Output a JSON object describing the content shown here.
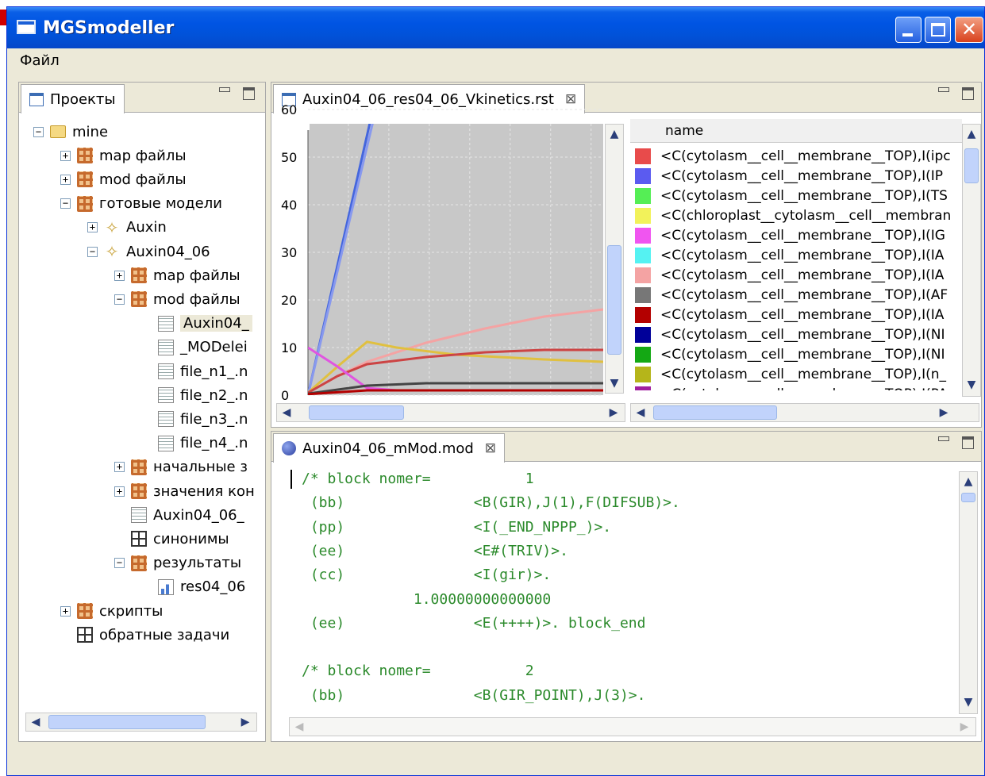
{
  "window": {
    "title": "MGSmodeller"
  },
  "menu": {
    "file": "Файл"
  },
  "projects_panel": {
    "tab_label": "Проекты",
    "tree": [
      {
        "label": "mine",
        "icon": "folder-icon",
        "expander": "−",
        "depth": 0
      },
      {
        "label": "map файлы",
        "icon": "package-icon",
        "expander": "+",
        "depth": 1
      },
      {
        "label": "mod файлы",
        "icon": "package-icon",
        "expander": "+",
        "depth": 1
      },
      {
        "label": "готовые модели",
        "icon": "package-icon",
        "expander": "−",
        "depth": 1
      },
      {
        "label": "Auxin",
        "icon": "model-icon",
        "expander": "+",
        "depth": 2
      },
      {
        "label": "Auxin04_06",
        "icon": "model-icon",
        "expander": "−",
        "depth": 2
      },
      {
        "label": "map файлы",
        "icon": "package-icon",
        "expander": "+",
        "depth": 3
      },
      {
        "label": "mod файлы",
        "icon": "package-icon",
        "expander": "−",
        "depth": 3
      },
      {
        "label": "Auxin04_",
        "icon": "document-icon",
        "expander": "",
        "depth": 4,
        "selected": true
      },
      {
        "label": "_MODelei",
        "icon": "document-icon",
        "expander": "",
        "depth": 4
      },
      {
        "label": "file_n1_.n",
        "icon": "document-icon",
        "expander": "",
        "depth": 4
      },
      {
        "label": "file_n2_.n",
        "icon": "document-icon",
        "expander": "",
        "depth": 4
      },
      {
        "label": "file_n3_.n",
        "icon": "document-icon",
        "expander": "",
        "depth": 4
      },
      {
        "label": "file_n4_.n",
        "icon": "document-icon",
        "expander": "",
        "depth": 4
      },
      {
        "label": "начальные з",
        "icon": "package-icon",
        "expander": "+",
        "depth": 3
      },
      {
        "label": "значения кон",
        "icon": "package-icon",
        "expander": "+",
        "depth": 3
      },
      {
        "label": "Auxin04_06_",
        "icon": "document-icon",
        "expander": "",
        "depth": 3
      },
      {
        "label": "синонимы",
        "icon": "grid-icon",
        "expander": "",
        "depth": 3
      },
      {
        "label": "результаты",
        "icon": "package-icon",
        "expander": "−",
        "depth": 3
      },
      {
        "label": "res04_06",
        "icon": "chart-document-icon",
        "expander": "",
        "depth": 4
      },
      {
        "label": "скрипты",
        "icon": "package-icon",
        "expander": "+",
        "depth": 1
      },
      {
        "label": "обратные задачи",
        "icon": "grid-icon",
        "expander": "",
        "depth": 1
      }
    ]
  },
  "result_panel": {
    "tab_label": "Auxin04_06_res04_06_Vkinetics.rst",
    "legend_header": "name",
    "legend": [
      {
        "label": "<C(cytolasm__cell__membrane__TOP),I(ipc",
        "color": "#e84b4b"
      },
      {
        "label": "<C(cytolasm__cell__membrane__TOP),I(IP",
        "color": "#5b5bf0"
      },
      {
        "label": "<C(cytolasm__cell__membrane__TOP),I(TS",
        "color": "#55ee55"
      },
      {
        "label": "<C(chloroplast__cytolasm__cell__membran",
        "color": "#f2f25a"
      },
      {
        "label": "<C(cytolasm__cell__membrane__TOP),I(IG",
        "color": "#f055f0"
      },
      {
        "label": "<C(cytolasm__cell__membrane__TOP),I(IA",
        "color": "#55f2f2"
      },
      {
        "label": "<C(cytolasm__cell__membrane__TOP),I(IA",
        "color": "#f4a3a3"
      },
      {
        "label": "<C(cytolasm__cell__membrane__TOP),I(AF",
        "color": "#777777"
      },
      {
        "label": "<C(cytolasm__cell__membrane__TOP),I(IA",
        "color": "#b30000"
      },
      {
        "label": "<C(cytolasm__cell__membrane__TOP),I(NI",
        "color": "#000099"
      },
      {
        "label": "<C(cytolasm__cell__membrane__TOP),I(NI",
        "color": "#14a814"
      },
      {
        "label": "<C(cytolasm__cell__membrane__TOP),I(n_",
        "color": "#b5b51a"
      },
      {
        "label": "<C(cytolasm__cell__membrane__TOP),I(PA",
        "color": "#a020a0"
      }
    ]
  },
  "chart_data": {
    "type": "line",
    "title": "",
    "xlabel": "",
    "ylabel": "",
    "ylim": [
      0,
      57
    ],
    "xlim": [
      0,
      10
    ],
    "y_ticks": [
      "0",
      "10",
      "20",
      "30",
      "40",
      "50",
      "60"
    ],
    "grid": true,
    "background": "#c8c8c8",
    "series": [
      {
        "color": "#4466dd",
        "x": [
          0,
          2.2
        ],
        "y": [
          0,
          60
        ]
      },
      {
        "color": "#8899ee",
        "x": [
          0,
          2.3
        ],
        "y": [
          0,
          60
        ]
      },
      {
        "color": "#f4a3a3",
        "x": [
          0,
          1,
          2,
          4,
          6,
          8,
          10
        ],
        "y": [
          0.5,
          4,
          7,
          11,
          14,
          16.5,
          18
        ]
      },
      {
        "color": "#e0c040",
        "x": [
          0,
          1,
          2,
          3,
          5,
          8,
          10
        ],
        "y": [
          0.5,
          6,
          11.2,
          10,
          8.5,
          7.5,
          7
        ]
      },
      {
        "color": "#cc4444",
        "x": [
          0,
          1,
          2,
          4,
          6,
          8,
          10
        ],
        "y": [
          0.5,
          4,
          6.5,
          8,
          9,
          9.5,
          9.5
        ]
      },
      {
        "color": "#e055e0",
        "x": [
          0,
          1,
          2,
          3
        ],
        "y": [
          10,
          6,
          1.5,
          1
        ]
      },
      {
        "color": "#444444",
        "x": [
          0,
          2,
          4,
          6,
          8,
          10
        ],
        "y": [
          0.3,
          2,
          2.5,
          2.5,
          2.5,
          2.5
        ]
      },
      {
        "color": "#b30000",
        "x": [
          0,
          2,
          4,
          6,
          8,
          10
        ],
        "y": [
          0.2,
          1,
          1,
          1,
          1,
          1
        ]
      }
    ]
  },
  "code_panel": {
    "tab_label": "Auxin04_06_mMod.mod",
    "lines": [
      "/* block nomer=           1",
      " (bb)               <B(GIR),J(1),F(DIFSUB)>.",
      " (pp)               <I(_END_NPPP_)>.",
      " (ee)               <E#(TRIV)>.",
      " (cc)               <I(gir)>.",
      "             1.00000000000000",
      " (ee)               <E(++++)>. block_end",
      "",
      "/* block nomer=           2",
      " (bb)               <B(GIR_POINT),J(3)>."
    ]
  }
}
